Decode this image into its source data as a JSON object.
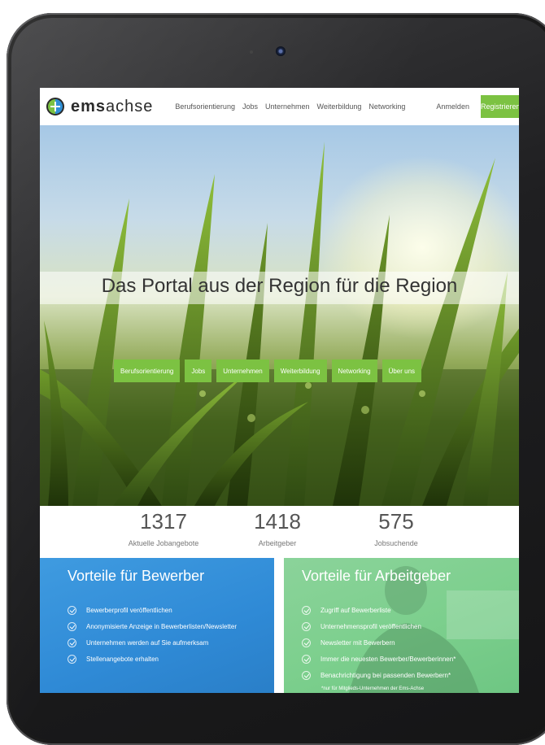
{
  "navbar": {
    "brand_prefix": "ems",
    "brand_suffix": "achse",
    "links": [
      "Berufsorientierung",
      "Jobs",
      "Unternehmen",
      "Weiterbildung",
      "Networking"
    ],
    "login": "Anmelden",
    "register": "Registrieren"
  },
  "hero": {
    "title": "Das Portal aus der Region für die Region",
    "buttons": [
      "Berufsorientierung",
      "Jobs",
      "Unternehmen",
      "Weiterbildung",
      "Networking",
      "Über uns"
    ]
  },
  "stats": [
    {
      "value": "1317",
      "label": "Aktuelle Jobangebote"
    },
    {
      "value": "1418",
      "label": "Arbeitgeber"
    },
    {
      "value": "575",
      "label": "Jobsuchende"
    }
  ],
  "panels": {
    "applicants": {
      "title": "Vorteile für Bewerber",
      "items": [
        "Bewerberprofil veröffentlichen",
        "Anonymisierte Anzeige in Bewerberlisten/Newsletter",
        "Unternehmen werden auf Sie aufmerksam",
        "Stellenangebote erhalten"
      ]
    },
    "employers": {
      "title": "Vorteile für Arbeitgeber",
      "items": [
        "Zugriff auf Bewerberliste",
        "Unternehmensprofil veröffentlichen",
        "Newsletter mit Bewerbern",
        "Immer die neuesten Bewerber/Bewerberinnen*",
        "Benachrichtigung bei passenden Bewerbern*"
      ],
      "footnote": "*nur für Mitglieds-Unternehmen der Ems-Achse"
    }
  },
  "colors": {
    "accent_green": "#7cc242",
    "panel_blue": "#2f8ad6",
    "panel_green": "#7ccf8d",
    "device_frame": "#1f1f21"
  },
  "icons": {
    "logo": "emsachse-logo-icon",
    "check": "check-circle-icon"
  }
}
